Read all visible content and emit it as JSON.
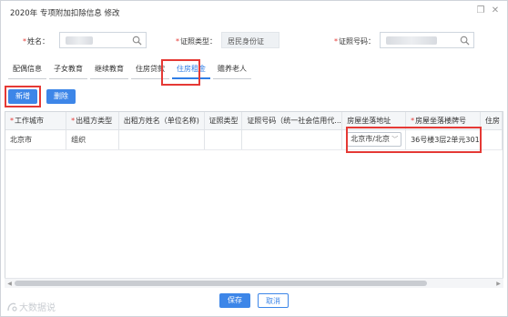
{
  "window": {
    "title": "2020年 专项附加扣除信息 修改",
    "minimize_icon": "restore-icon",
    "close_icon": "close-icon"
  },
  "form": {
    "name_label": "姓名：",
    "id_type_label": "证照类型：",
    "id_type_value": "居民身份证",
    "id_number_label": "证照号码："
  },
  "tabs": [
    {
      "label": "配偶信息"
    },
    {
      "label": "子女教育"
    },
    {
      "label": "继续教育"
    },
    {
      "label": "住房贷款"
    },
    {
      "label": "住房租金"
    },
    {
      "label": "赡养老人"
    }
  ],
  "toolbar": {
    "add_label": "新增",
    "delete_label": "删除"
  },
  "table": {
    "columns": [
      "工作城市",
      "出租方类型",
      "出租方姓名（单位名称)",
      "证照类型",
      "证照号码（统一社会信用代...",
      "房屋坐落地址",
      "房屋坐落楼牌号",
      "住房"
    ],
    "row": {
      "city": "北京市",
      "lessor_type": "组织",
      "lessor_name": "",
      "id_type": "",
      "id_number": "",
      "address": "北京市/北京",
      "building_no": "36号楼3层2单元301"
    }
  },
  "footer": {
    "save_label": "保存",
    "cancel_label": "取消"
  },
  "watermark": "大数据说"
}
